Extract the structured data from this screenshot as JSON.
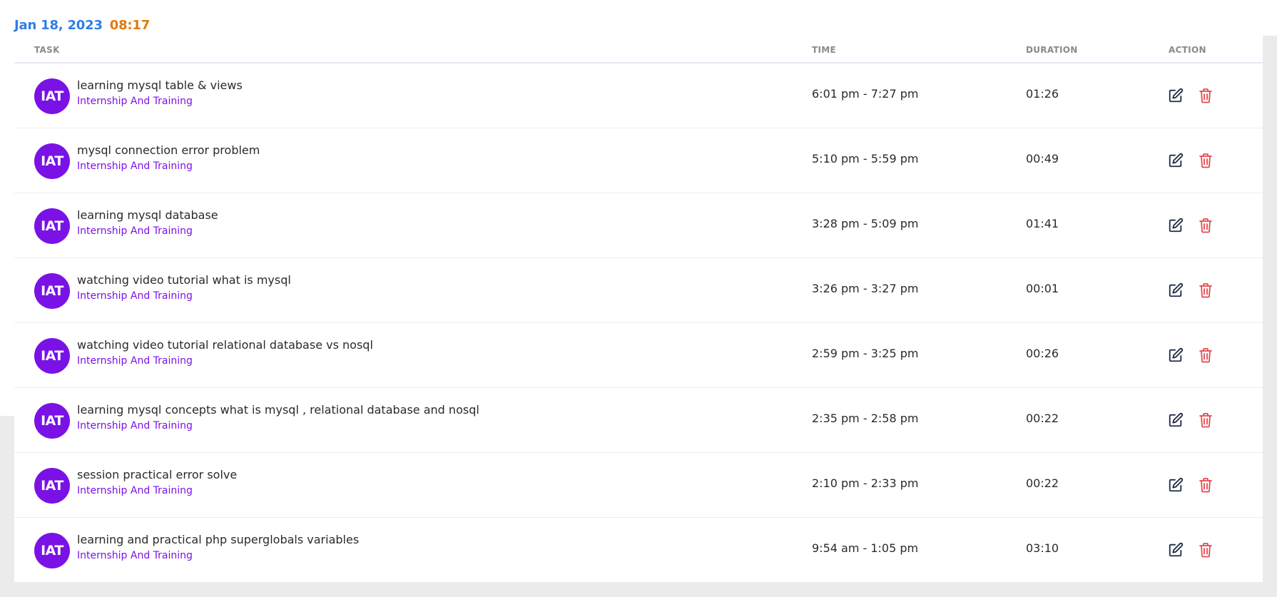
{
  "header": {
    "date": "Jan 18, 2023",
    "time": "08:17"
  },
  "table": {
    "columns": {
      "task": "TASK",
      "time": "TIME",
      "duration": "DURATION",
      "action": "ACTION"
    },
    "rows": [
      {
        "avatar": "IAT",
        "title": "learning mysql table & views",
        "category": "Internship And Training",
        "time": "6:01 pm - 7:27 pm",
        "duration": "01:26"
      },
      {
        "avatar": "IAT",
        "title": "mysql connection error problem",
        "category": "Internship And Training",
        "time": "5:10 pm - 5:59 pm",
        "duration": "00:49"
      },
      {
        "avatar": "IAT",
        "title": "learning mysql database",
        "category": "Internship And Training",
        "time": "3:28 pm - 5:09 pm",
        "duration": "01:41"
      },
      {
        "avatar": "IAT",
        "title": "watching video tutorial what is mysql",
        "category": "Internship And Training",
        "time": "3:26 pm - 3:27 pm",
        "duration": "00:01"
      },
      {
        "avatar": "IAT",
        "title": "watching video tutorial relational database vs nosql",
        "category": "Internship And Training",
        "time": "2:59 pm - 3:25 pm",
        "duration": "00:26"
      },
      {
        "avatar": "IAT",
        "title": "learning mysql concepts what is mysql , relational database and nosql",
        "category": "Internship And Training",
        "time": "2:35 pm - 2:58 pm",
        "duration": "00:22"
      },
      {
        "avatar": "IAT",
        "title": "session practical error solve",
        "category": "Internship And Training",
        "time": "2:10 pm - 2:33 pm",
        "duration": "00:22"
      },
      {
        "avatar": "IAT",
        "title": "learning and practical php superglobals variables",
        "category": "Internship And Training",
        "time": "9:54 am - 1:05 pm",
        "duration": "03:10"
      }
    ]
  },
  "colors": {
    "date": "#2f7ee6",
    "time": "#e07a10",
    "avatar_bg": "#7a12e6",
    "category": "#7a12e6",
    "edit_icon": "#1f2a44",
    "delete_icon": "#e5484d",
    "download_button": "#1a73e8"
  },
  "icons": {
    "download": "download-icon",
    "edit": "edit-icon",
    "delete": "trash-icon"
  }
}
